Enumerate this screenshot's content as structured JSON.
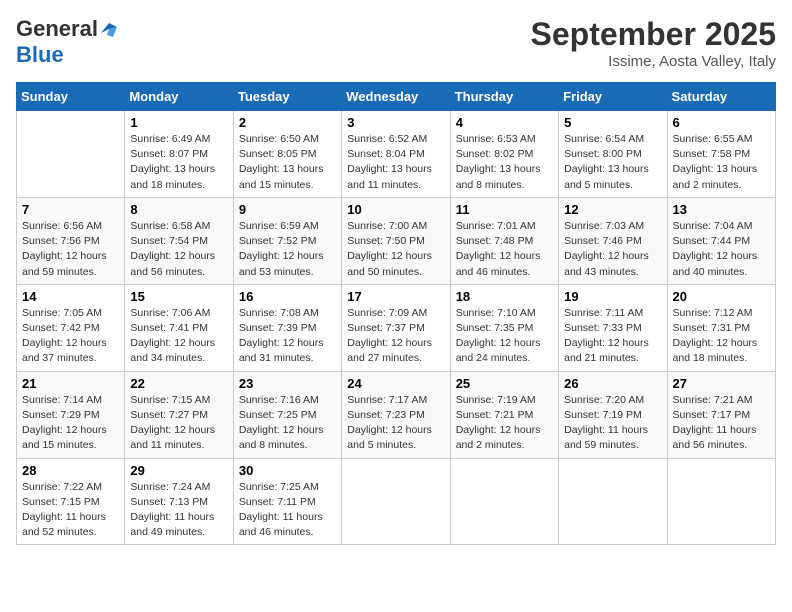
{
  "header": {
    "logo_line1": "General",
    "logo_line2": "Blue",
    "month_title": "September 2025",
    "location": "Issime, Aosta Valley, Italy"
  },
  "days_of_week": [
    "Sunday",
    "Monday",
    "Tuesday",
    "Wednesday",
    "Thursday",
    "Friday",
    "Saturday"
  ],
  "weeks": [
    [
      {
        "day": "",
        "sunrise": "",
        "sunset": "",
        "daylight": ""
      },
      {
        "day": "1",
        "sunrise": "Sunrise: 6:49 AM",
        "sunset": "Sunset: 8:07 PM",
        "daylight": "Daylight: 13 hours and 18 minutes."
      },
      {
        "day": "2",
        "sunrise": "Sunrise: 6:50 AM",
        "sunset": "Sunset: 8:05 PM",
        "daylight": "Daylight: 13 hours and 15 minutes."
      },
      {
        "day": "3",
        "sunrise": "Sunrise: 6:52 AM",
        "sunset": "Sunset: 8:04 PM",
        "daylight": "Daylight: 13 hours and 11 minutes."
      },
      {
        "day": "4",
        "sunrise": "Sunrise: 6:53 AM",
        "sunset": "Sunset: 8:02 PM",
        "daylight": "Daylight: 13 hours and 8 minutes."
      },
      {
        "day": "5",
        "sunrise": "Sunrise: 6:54 AM",
        "sunset": "Sunset: 8:00 PM",
        "daylight": "Daylight: 13 hours and 5 minutes."
      },
      {
        "day": "6",
        "sunrise": "Sunrise: 6:55 AM",
        "sunset": "Sunset: 7:58 PM",
        "daylight": "Daylight: 13 hours and 2 minutes."
      }
    ],
    [
      {
        "day": "7",
        "sunrise": "Sunrise: 6:56 AM",
        "sunset": "Sunset: 7:56 PM",
        "daylight": "Daylight: 12 hours and 59 minutes."
      },
      {
        "day": "8",
        "sunrise": "Sunrise: 6:58 AM",
        "sunset": "Sunset: 7:54 PM",
        "daylight": "Daylight: 12 hours and 56 minutes."
      },
      {
        "day": "9",
        "sunrise": "Sunrise: 6:59 AM",
        "sunset": "Sunset: 7:52 PM",
        "daylight": "Daylight: 12 hours and 53 minutes."
      },
      {
        "day": "10",
        "sunrise": "Sunrise: 7:00 AM",
        "sunset": "Sunset: 7:50 PM",
        "daylight": "Daylight: 12 hours and 50 minutes."
      },
      {
        "day": "11",
        "sunrise": "Sunrise: 7:01 AM",
        "sunset": "Sunset: 7:48 PM",
        "daylight": "Daylight: 12 hours and 46 minutes."
      },
      {
        "day": "12",
        "sunrise": "Sunrise: 7:03 AM",
        "sunset": "Sunset: 7:46 PM",
        "daylight": "Daylight: 12 hours and 43 minutes."
      },
      {
        "day": "13",
        "sunrise": "Sunrise: 7:04 AM",
        "sunset": "Sunset: 7:44 PM",
        "daylight": "Daylight: 12 hours and 40 minutes."
      }
    ],
    [
      {
        "day": "14",
        "sunrise": "Sunrise: 7:05 AM",
        "sunset": "Sunset: 7:42 PM",
        "daylight": "Daylight: 12 hours and 37 minutes."
      },
      {
        "day": "15",
        "sunrise": "Sunrise: 7:06 AM",
        "sunset": "Sunset: 7:41 PM",
        "daylight": "Daylight: 12 hours and 34 minutes."
      },
      {
        "day": "16",
        "sunrise": "Sunrise: 7:08 AM",
        "sunset": "Sunset: 7:39 PM",
        "daylight": "Daylight: 12 hours and 31 minutes."
      },
      {
        "day": "17",
        "sunrise": "Sunrise: 7:09 AM",
        "sunset": "Sunset: 7:37 PM",
        "daylight": "Daylight: 12 hours and 27 minutes."
      },
      {
        "day": "18",
        "sunrise": "Sunrise: 7:10 AM",
        "sunset": "Sunset: 7:35 PM",
        "daylight": "Daylight: 12 hours and 24 minutes."
      },
      {
        "day": "19",
        "sunrise": "Sunrise: 7:11 AM",
        "sunset": "Sunset: 7:33 PM",
        "daylight": "Daylight: 12 hours and 21 minutes."
      },
      {
        "day": "20",
        "sunrise": "Sunrise: 7:12 AM",
        "sunset": "Sunset: 7:31 PM",
        "daylight": "Daylight: 12 hours and 18 minutes."
      }
    ],
    [
      {
        "day": "21",
        "sunrise": "Sunrise: 7:14 AM",
        "sunset": "Sunset: 7:29 PM",
        "daylight": "Daylight: 12 hours and 15 minutes."
      },
      {
        "day": "22",
        "sunrise": "Sunrise: 7:15 AM",
        "sunset": "Sunset: 7:27 PM",
        "daylight": "Daylight: 12 hours and 11 minutes."
      },
      {
        "day": "23",
        "sunrise": "Sunrise: 7:16 AM",
        "sunset": "Sunset: 7:25 PM",
        "daylight": "Daylight: 12 hours and 8 minutes."
      },
      {
        "day": "24",
        "sunrise": "Sunrise: 7:17 AM",
        "sunset": "Sunset: 7:23 PM",
        "daylight": "Daylight: 12 hours and 5 minutes."
      },
      {
        "day": "25",
        "sunrise": "Sunrise: 7:19 AM",
        "sunset": "Sunset: 7:21 PM",
        "daylight": "Daylight: 12 hours and 2 minutes."
      },
      {
        "day": "26",
        "sunrise": "Sunrise: 7:20 AM",
        "sunset": "Sunset: 7:19 PM",
        "daylight": "Daylight: 11 hours and 59 minutes."
      },
      {
        "day": "27",
        "sunrise": "Sunrise: 7:21 AM",
        "sunset": "Sunset: 7:17 PM",
        "daylight": "Daylight: 11 hours and 56 minutes."
      }
    ],
    [
      {
        "day": "28",
        "sunrise": "Sunrise: 7:22 AM",
        "sunset": "Sunset: 7:15 PM",
        "daylight": "Daylight: 11 hours and 52 minutes."
      },
      {
        "day": "29",
        "sunrise": "Sunrise: 7:24 AM",
        "sunset": "Sunset: 7:13 PM",
        "daylight": "Daylight: 11 hours and 49 minutes."
      },
      {
        "day": "30",
        "sunrise": "Sunrise: 7:25 AM",
        "sunset": "Sunset: 7:11 PM",
        "daylight": "Daylight: 11 hours and 46 minutes."
      },
      {
        "day": "",
        "sunrise": "",
        "sunset": "",
        "daylight": ""
      },
      {
        "day": "",
        "sunrise": "",
        "sunset": "",
        "daylight": ""
      },
      {
        "day": "",
        "sunrise": "",
        "sunset": "",
        "daylight": ""
      },
      {
        "day": "",
        "sunrise": "",
        "sunset": "",
        "daylight": ""
      }
    ]
  ]
}
